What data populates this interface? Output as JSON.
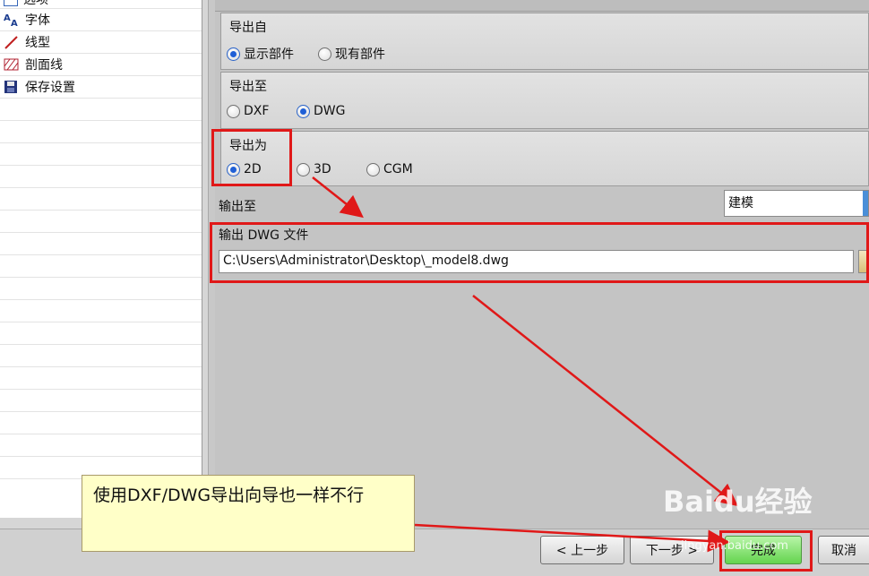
{
  "sidebar": {
    "items": [
      {
        "label": "选项",
        "icon": "options-icon"
      },
      {
        "label": "字体",
        "icon": "font-icon"
      },
      {
        "label": "线型",
        "icon": "linetype-icon"
      },
      {
        "label": "剖面线",
        "icon": "hatch-icon"
      },
      {
        "label": "保存设置",
        "icon": "save-settings-icon"
      }
    ]
  },
  "export_from": {
    "label": "导出自",
    "options": [
      "显示部件",
      "现有部件"
    ],
    "selected": "显示部件"
  },
  "export_to": {
    "label": "导出至",
    "options": [
      "DXF",
      "DWG"
    ],
    "selected": "DWG"
  },
  "export_as": {
    "label": "导出为",
    "options": [
      "2D",
      "3D",
      "CGM"
    ],
    "selected": "2D"
  },
  "output_to": {
    "label": "输出至",
    "value": "建模"
  },
  "output_file": {
    "label": "输出 DWG 文件",
    "value": "C:\\Users\\Administrator\\Desktop\\_model8.dwg"
  },
  "buttons": {
    "back": "< 上一步",
    "next": "下一步 >",
    "finish": "完成",
    "cancel": "取消"
  },
  "annotation": {
    "text": "使用DXF/DWG导出向导也一样不行"
  },
  "watermark": {
    "logo": "Baidu经验",
    "url": "jingyan.baidu.com"
  },
  "colors": {
    "highlight": "#e01818",
    "finish_button": "#7ee06a",
    "callout_bg": "#ffffc8"
  }
}
